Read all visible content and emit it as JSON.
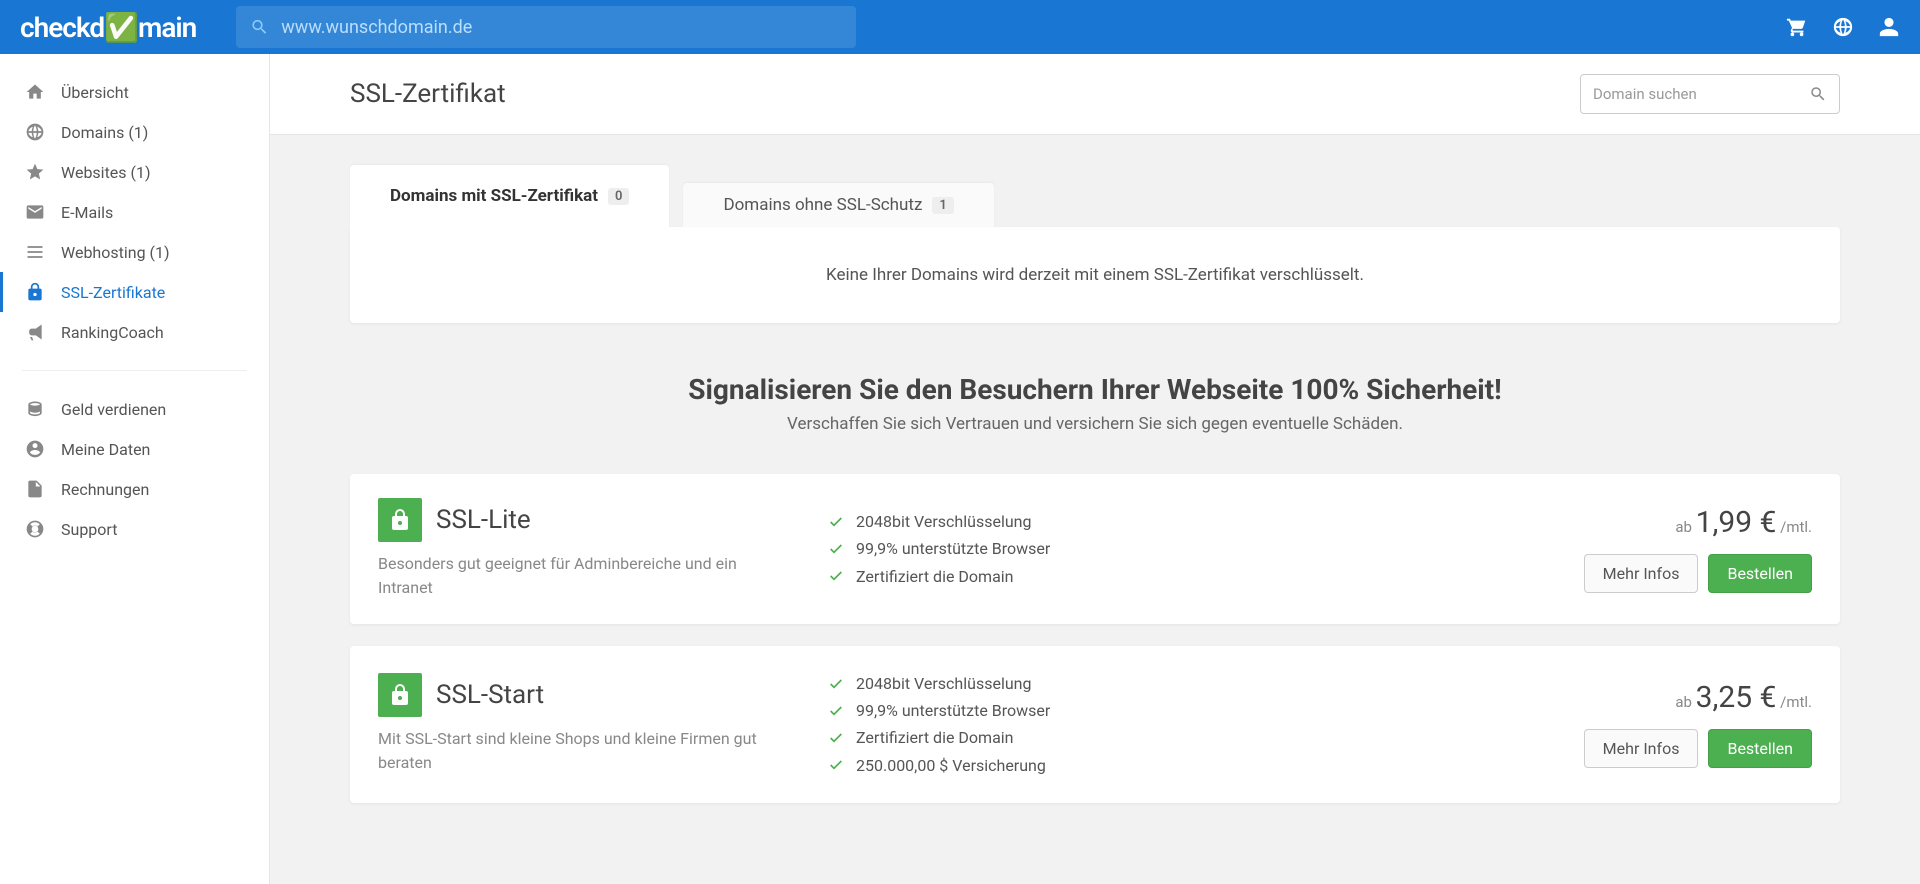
{
  "header": {
    "logo_text": "checkdomain",
    "search_placeholder": "www.wunschdomain.de"
  },
  "sidebar": {
    "items_primary": [
      {
        "label": "Übersicht",
        "icon": "home"
      },
      {
        "label": "Domains (1)",
        "icon": "globe"
      },
      {
        "label": "Websites (1)",
        "icon": "star"
      },
      {
        "label": "E-Mails",
        "icon": "mail"
      },
      {
        "label": "Webhosting (1)",
        "icon": "list"
      },
      {
        "label": "SSL-Zertifikate",
        "icon": "lock",
        "active": true
      },
      {
        "label": "RankingCoach",
        "icon": "megaphone"
      }
    ],
    "items_secondary": [
      {
        "label": "Geld verdienen",
        "icon": "coins"
      },
      {
        "label": "Meine Daten",
        "icon": "user-circle"
      },
      {
        "label": "Rechnungen",
        "icon": "document"
      },
      {
        "label": "Support",
        "icon": "life-ring"
      }
    ]
  },
  "page": {
    "title": "SSL-Zertifikat",
    "inline_search_placeholder": "Domain suchen"
  },
  "tabs": [
    {
      "label": "Domains mit SSL-Zertifikat",
      "count": "0",
      "active": true
    },
    {
      "label": "Domains ohne SSL-Schutz",
      "count": "1",
      "active": false
    }
  ],
  "empty_message": "Keine Ihrer Domains wird derzeit mit einem SSL-Zertifikat verschlüsselt.",
  "promo": {
    "headline": "Signalisieren Sie den Besuchern Ihrer Webseite 100% Sicherheit!",
    "subline": "Verschaffen Sie sich Vertrauen und versichern Sie sich gegen eventuelle Schäden."
  },
  "products": [
    {
      "name": "SSL-Lite",
      "desc": "Besonders gut geeignet für Adminbereiche und ein Intranet",
      "features": [
        "2048bit Verschlüsselung",
        "99,9% unterstützte Browser",
        "Zertifiziert die Domain"
      ],
      "price_prefix": "ab ",
      "price": "1,99 €",
      "price_suffix": " /mtl.",
      "info_label": "Mehr Infos",
      "order_label": "Bestellen"
    },
    {
      "name": "SSL-Start",
      "desc": "Mit SSL-Start sind kleine Shops und kleine Firmen gut beraten",
      "features": [
        "2048bit Verschlüsselung",
        "99,9% unterstützte Browser",
        "Zertifiziert die Domain",
        "250.000,00 $ Versicherung"
      ],
      "price_prefix": "ab ",
      "price": "3,25 €",
      "price_suffix": " /mtl.",
      "info_label": "Mehr Infos",
      "order_label": "Bestellen"
    }
  ]
}
